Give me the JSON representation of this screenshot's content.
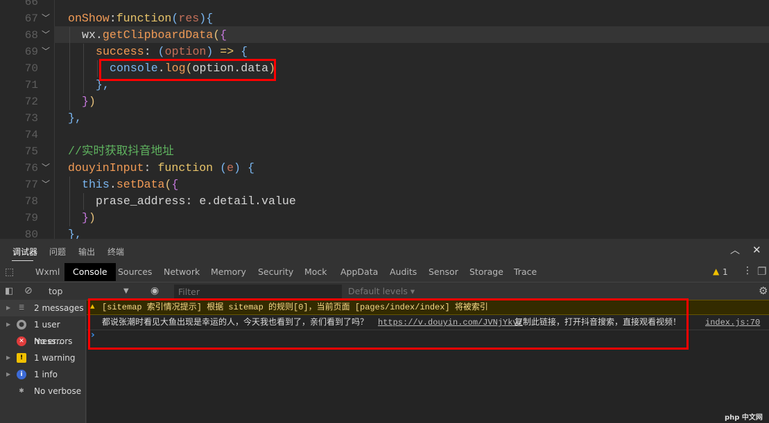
{
  "editor": {
    "line_numbers": [
      "66",
      "67",
      "68",
      "69",
      "70",
      "71",
      "72",
      "73",
      "74",
      "75",
      "76",
      "77",
      "78",
      "79",
      "80"
    ],
    "lines": [
      {
        "indent": 0,
        "tokens": []
      },
      {
        "indent": 0,
        "tokens": [
          [
            "onShow",
            "k"
          ],
          [
            ":",
            "w"
          ],
          [
            "function",
            "f"
          ],
          [
            "(",
            "b"
          ],
          [
            "res",
            "p"
          ],
          [
            "){",
            "b"
          ]
        ]
      },
      {
        "indent": 1,
        "tokens": [
          [
            "wx.",
            "w"
          ],
          [
            "getClipboardData",
            "k"
          ],
          [
            "(",
            "y"
          ],
          [
            "{",
            "m"
          ]
        ]
      },
      {
        "indent": 2,
        "tokens": [
          [
            "success",
            "k"
          ],
          [
            ": ",
            "w"
          ],
          [
            "(",
            "b"
          ],
          [
            "option",
            "p"
          ],
          [
            ") ",
            "b"
          ],
          [
            "=>",
            "f"
          ],
          [
            " {",
            "b"
          ]
        ]
      },
      {
        "indent": 3,
        "tokens": [
          [
            "console",
            "b"
          ],
          [
            ".",
            "w"
          ],
          [
            "log",
            "k"
          ],
          [
            "(",
            "y"
          ],
          [
            "option.data",
            "w"
          ],
          [
            ")",
            "y"
          ]
        ]
      },
      {
        "indent": 2,
        "tokens": [
          [
            "},",
            "b"
          ]
        ]
      },
      {
        "indent": 1,
        "tokens": [
          [
            "}",
            "m"
          ],
          [
            ")",
            "y"
          ]
        ]
      },
      {
        "indent": 0,
        "tokens": [
          [
            "},",
            "b"
          ]
        ]
      },
      {
        "indent": 0,
        "tokens": []
      },
      {
        "indent": 0,
        "tokens": [
          [
            "//实时获取抖音地址",
            "c"
          ]
        ]
      },
      {
        "indent": 0,
        "tokens": [
          [
            "douyinInput",
            "k"
          ],
          [
            ": ",
            "w"
          ],
          [
            "function",
            "f"
          ],
          [
            " (",
            "b"
          ],
          [
            "e",
            "p"
          ],
          [
            ") {",
            "b"
          ]
        ]
      },
      {
        "indent": 1,
        "tokens": [
          [
            "this",
            "b"
          ],
          [
            ".",
            "w"
          ],
          [
            "setData",
            "k"
          ],
          [
            "(",
            "y"
          ],
          [
            "{",
            "m"
          ]
        ]
      },
      {
        "indent": 2,
        "tokens": [
          [
            "prase_address",
            "w"
          ],
          [
            ": e.detail.value",
            "w"
          ]
        ]
      },
      {
        "indent": 1,
        "tokens": [
          [
            "}",
            "m"
          ],
          [
            ")",
            "y"
          ]
        ]
      },
      {
        "indent": 0,
        "tokens": [
          [
            "},",
            "b"
          ]
        ]
      }
    ]
  },
  "panel": {
    "top_tabs": [
      "调试器",
      "问题",
      "输出",
      "终端"
    ],
    "devtools_tabs": [
      "Wxml",
      "Console",
      "Sources",
      "Network",
      "Memory",
      "Security",
      "Mock",
      "AppData",
      "Audits",
      "Sensor",
      "Storage",
      "Trace"
    ],
    "active_tab": "Console",
    "warning_count": "1",
    "context": "top",
    "filter_placeholder": "Filter",
    "levels": "Default levels ▾"
  },
  "sidebar": [
    {
      "label": "2 messages",
      "icon": "list-icon",
      "arrow": true
    },
    {
      "label": "1 user mess...",
      "icon": "user-icon",
      "arrow": true
    },
    {
      "label": "No errors",
      "icon": "error-icon",
      "arrow": false
    },
    {
      "label": "1 warning",
      "icon": "warning-icon",
      "arrow": true
    },
    {
      "label": "1 info",
      "icon": "info-icon",
      "arrow": true
    },
    {
      "label": "No verbose",
      "icon": "bug-icon",
      "arrow": false
    }
  ],
  "console": {
    "warning": "[sitemap 索引情况提示] 根据 sitemap 的规则[0]，当前页面 [pages/index/index] 将被索引",
    "log_text1": "都说张潮时看见大鱼出现是幸运的人，今天我也看到了，亲们看到了吗？",
    "log_link": "https://v.douyin.com/JVNjYkv/",
    "log_text2": "复制此链接，打开抖音搜索，直接观看视频！",
    "source": "index.js:70",
    "prompt": "›"
  }
}
